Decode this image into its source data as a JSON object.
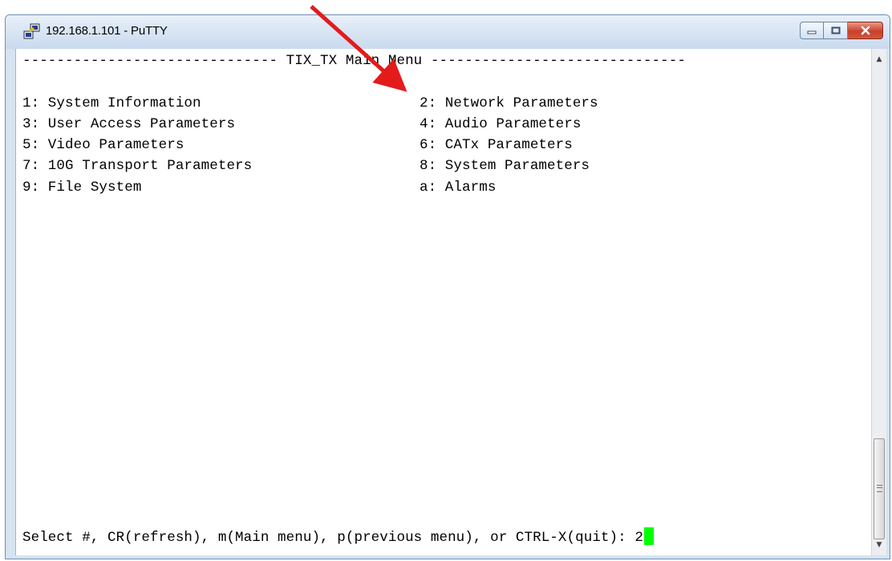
{
  "window": {
    "title": "192.168.1.101 - PuTTY",
    "icon": "putty-icon",
    "controls": {
      "minimize": "minimize-icon",
      "maximize": "maximize-icon",
      "close": "close-icon"
    }
  },
  "terminal": {
    "header_line": "------------------------------ TIX_TX Main Menu ------------------------------",
    "menu_left": [
      "1: System Information",
      "3: User Access Parameters",
      "5: Video Parameters",
      "7: 10G Transport Parameters",
      "9: File System"
    ],
    "menu_right": [
      "2: Network Parameters",
      "4: Audio Parameters",
      "6: CATx Parameters",
      "8: System Parameters",
      "a: Alarms"
    ],
    "prompt": "Select #, CR(refresh), m(Main menu), p(previous menu), or CTRL-X(quit): 2",
    "cursor_color": "#00ff00"
  },
  "annotation": {
    "arrow_color": "#e31b1b"
  }
}
